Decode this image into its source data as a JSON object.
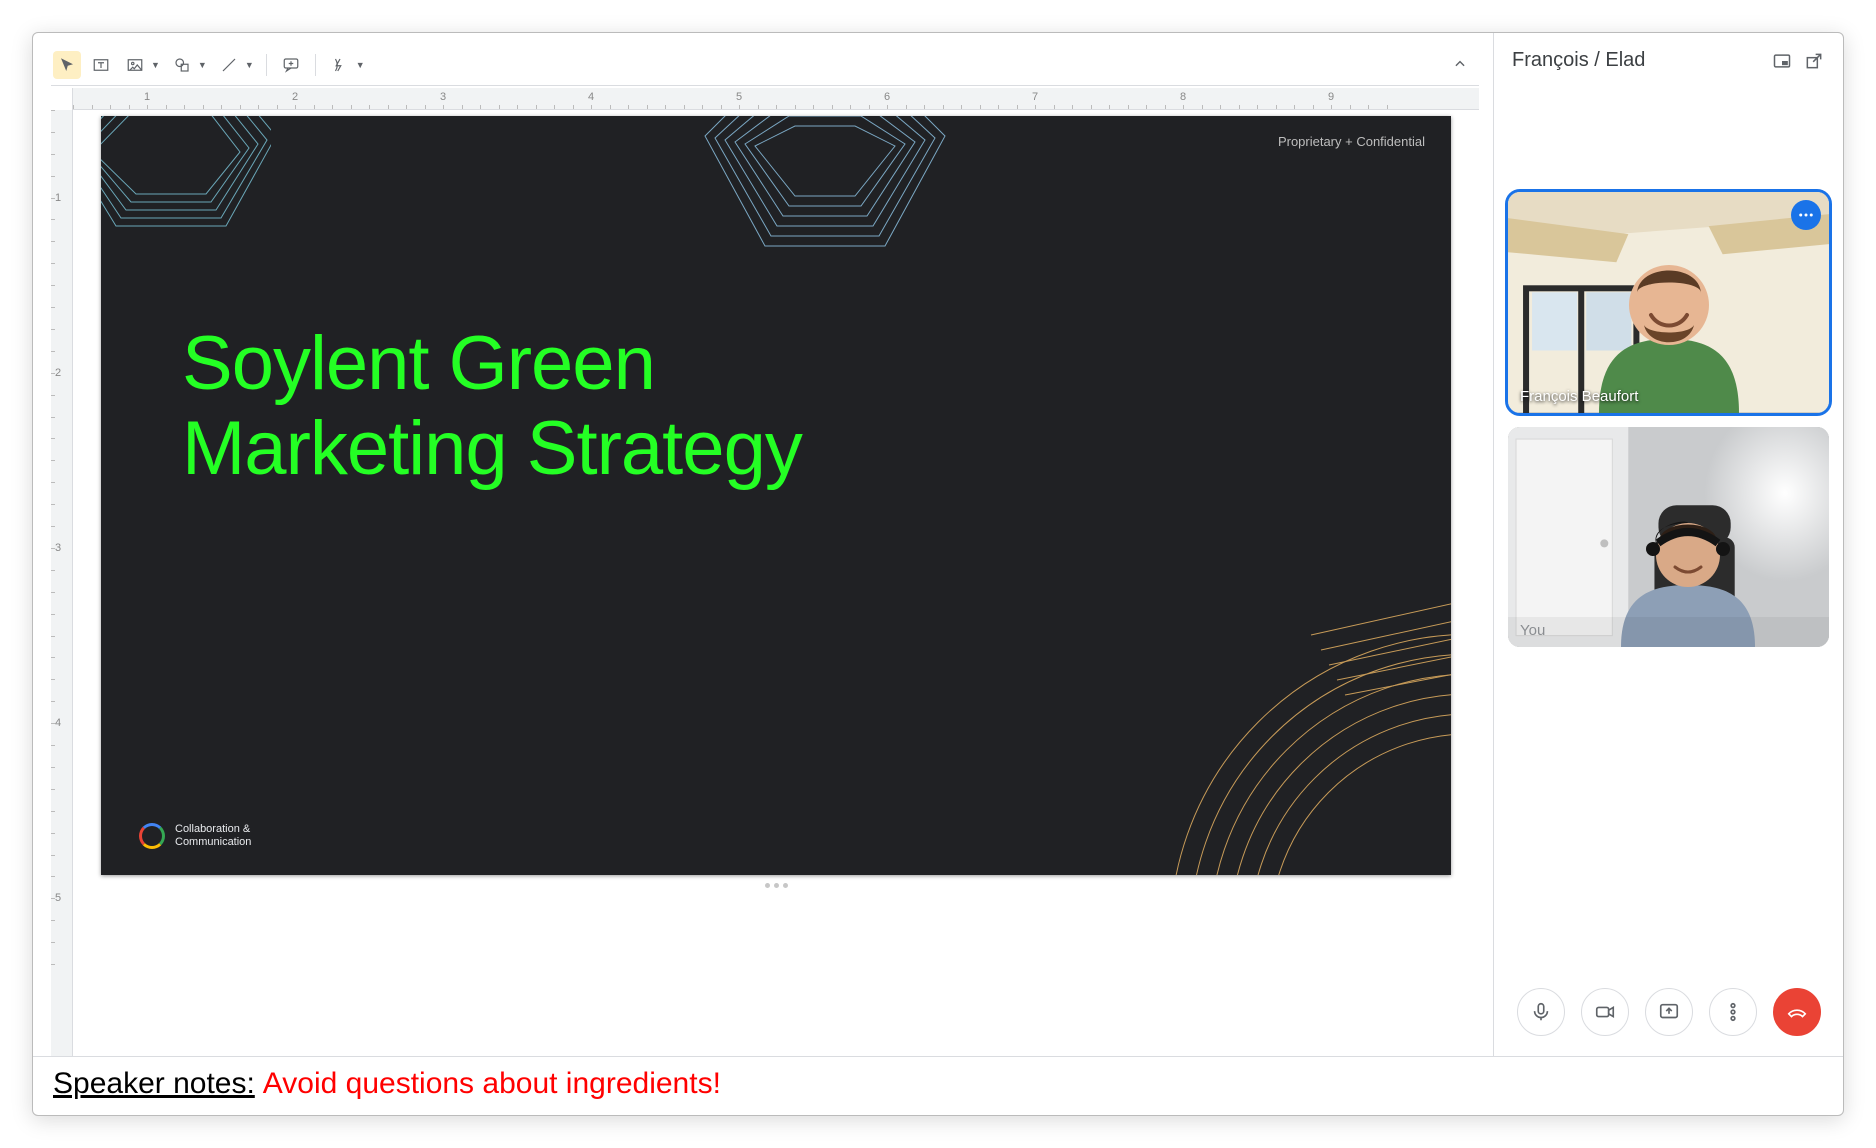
{
  "toolbar": {
    "select_tool": "Select",
    "textbox_tool": "Text box",
    "image_tool": "Image",
    "shape_tool": "Shape",
    "line_tool": "Line",
    "comment_tool": "Comment",
    "motion_tool": "Motion"
  },
  "ruler": {
    "h_labels": [
      "1",
      "2",
      "3",
      "4",
      "5",
      "6",
      "7",
      "8",
      "9"
    ],
    "v_labels": [
      "1",
      "2",
      "3",
      "4",
      "5"
    ]
  },
  "slide": {
    "confidential": "Proprietary + Confidential",
    "title_line1": "Soylent Green",
    "title_line2": "Marketing Strategy",
    "logo_line1": "Collaboration &",
    "logo_line2": "Communication"
  },
  "notes": {
    "label": "Speaker notes:",
    "text": "Avoid questions about ingredients!"
  },
  "meet": {
    "title": "François / Elad",
    "participants": [
      {
        "name": "François Beaufort",
        "active": true,
        "has_menu": true
      },
      {
        "name": "You",
        "active": false,
        "has_menu": false
      }
    ],
    "controls": {
      "mic": "Microphone",
      "cam": "Camera",
      "present": "Present screen",
      "more": "More options",
      "hangup": "Leave call"
    }
  }
}
